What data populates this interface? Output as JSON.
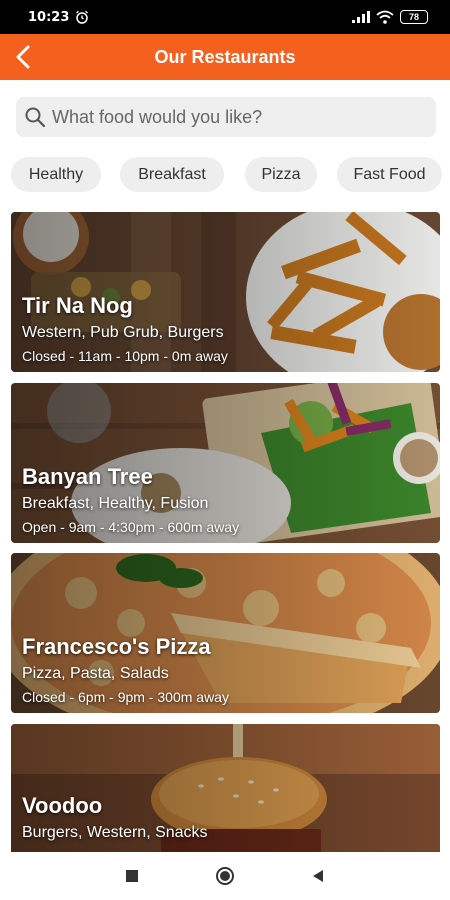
{
  "status_bar": {
    "time": "10:23",
    "battery": "78"
  },
  "header": {
    "title": "Our Restaurants"
  },
  "search": {
    "placeholder": "What food would you like?"
  },
  "filters": [
    "Healthy",
    "Breakfast",
    "Pizza",
    "Fast Food"
  ],
  "restaurants": [
    {
      "name": "Tir Na Nog",
      "cuisine": "Western, Pub Grub, Burgers",
      "status": "Closed - 11am - 10pm - 0m away"
    },
    {
      "name": "Banyan Tree",
      "cuisine": "Breakfast, Healthy, Fusion",
      "status": "Open - 9am - 4:30pm - 600m away"
    },
    {
      "name": "Francesco's Pizza",
      "cuisine": "Pizza, Pasta, Salads",
      "status": "Closed - 6pm - 9pm - 300m away"
    },
    {
      "name": "Voodoo",
      "cuisine": "Burgers, Western, Snacks",
      "status": ""
    }
  ],
  "colors": {
    "accent": "#f4611e"
  },
  "icons": [
    "back-arrow-icon",
    "search-icon",
    "alarm-icon",
    "signal-icon",
    "wifi-icon",
    "battery-icon",
    "nav-recents-icon",
    "nav-home-icon",
    "nav-back-icon"
  ]
}
